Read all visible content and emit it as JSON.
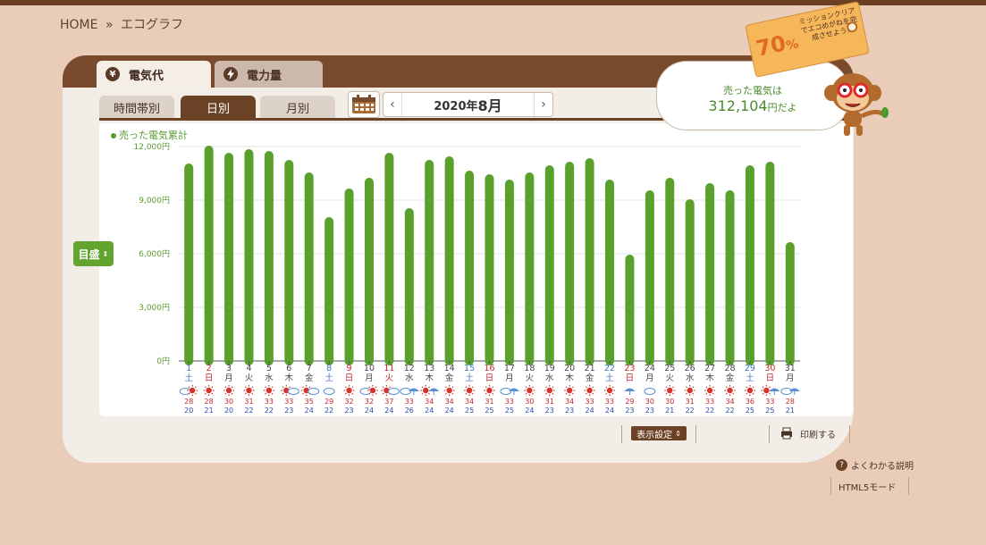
{
  "breadcrumb": {
    "home": "HOME",
    "sep": "»",
    "current": "エコグラフ"
  },
  "tabs": {
    "cost_icon": "¥",
    "cost_label": "電気代",
    "power_label": "電力量"
  },
  "subtabs": {
    "time": "時間帯別",
    "day": "日別",
    "month": "月別"
  },
  "date_nav": {
    "prev": "‹",
    "next": "›",
    "year": "2020年",
    "month": "8月"
  },
  "summary": {
    "line1": "売った電気は",
    "amount": "312,104",
    "unit": "円だよ"
  },
  "mission": {
    "percent": "70",
    "percent_unit": "%",
    "message": "ミッションクリアでエコめがねを完成させよう!"
  },
  "controls": {
    "scale_label": "目盛",
    "display_settings": "表示設定",
    "print": "印刷する",
    "help": "よくわかる説明",
    "html5": "HTML5モード"
  },
  "colors": {
    "bar": "#5aa02c",
    "saturday": "#3b73c4",
    "sunday": "#c4262c",
    "weekday": "#444444",
    "panel_brown": "#7a4a2c"
  },
  "chart_data": {
    "type": "bar",
    "series_label": "売った電気累計",
    "ylim": [
      0,
      12000
    ],
    "yticks": [
      "0円",
      "3,000円",
      "6,000円",
      "9,000円",
      "12,000円"
    ],
    "ytick_values": [
      0,
      3000,
      6000,
      9000,
      12000
    ],
    "categories": [
      "1",
      "2",
      "3",
      "4",
      "5",
      "6",
      "7",
      "8",
      "9",
      "10",
      "11",
      "12",
      "13",
      "14",
      "15",
      "16",
      "17",
      "18",
      "19",
      "20",
      "21",
      "22",
      "23",
      "24",
      "25",
      "26",
      "27",
      "28",
      "29",
      "30",
      "31"
    ],
    "weekdays": [
      "土",
      "日",
      "月",
      "火",
      "水",
      "木",
      "金",
      "土",
      "日",
      "月",
      "火",
      "水",
      "木",
      "金",
      "土",
      "日",
      "月",
      "火",
      "水",
      "木",
      "金",
      "土",
      "日",
      "月",
      "火",
      "水",
      "木",
      "金",
      "土",
      "日",
      "月"
    ],
    "day_type": [
      "sat",
      "sun",
      "wk",
      "wk",
      "wk",
      "wk",
      "wk",
      "sat",
      "sun",
      "wk",
      "hol",
      "wk",
      "wk",
      "wk",
      "sat",
      "sun",
      "wk",
      "wk",
      "wk",
      "wk",
      "wk",
      "sat",
      "sun",
      "wk",
      "wk",
      "wk",
      "wk",
      "wk",
      "sat",
      "sun",
      "wk"
    ],
    "weather": [
      "partly-cloudy-sunny",
      "sunny",
      "sunny",
      "sunny",
      "sunny",
      "sunny-cloudy",
      "sunny-cloudy",
      "cloudy",
      "sunny",
      "cloudy-sunny",
      "sunny-cloudy",
      "cloudy-rain",
      "sunny-rain",
      "sunny",
      "sunny",
      "sunny",
      "cloudy-rain",
      "sunny",
      "sunny",
      "sunny",
      "sunny",
      "sunny",
      "rain",
      "cloudy",
      "sunny",
      "sunny",
      "sunny",
      "sunny",
      "sunny",
      "sunny-rain",
      "cloudy-rain"
    ],
    "high_temp": [
      28,
      28,
      30,
      31,
      33,
      33,
      35,
      29,
      32,
      32,
      37,
      33,
      34,
      34,
      34,
      31,
      33,
      30,
      31,
      34,
      33,
      33,
      29,
      30,
      30,
      31,
      33,
      34,
      36,
      33,
      28
    ],
    "low_temp": [
      20,
      21,
      20,
      22,
      22,
      23,
      24,
      22,
      23,
      24,
      24,
      26,
      24,
      24,
      25,
      25,
      25,
      24,
      23,
      23,
      24,
      24,
      23,
      23,
      21,
      22,
      22,
      22,
      25,
      25,
      21
    ],
    "values": [
      10800,
      11800,
      11400,
      11600,
      11500,
      11000,
      10300,
      7800,
      9400,
      10000,
      11400,
      8300,
      11000,
      11200,
      10400,
      10200,
      9900,
      10300,
      10700,
      10900,
      11100,
      9900,
      5700,
      9300,
      10000,
      8800,
      9700,
      9300,
      10700,
      10900,
      6400
    ]
  }
}
